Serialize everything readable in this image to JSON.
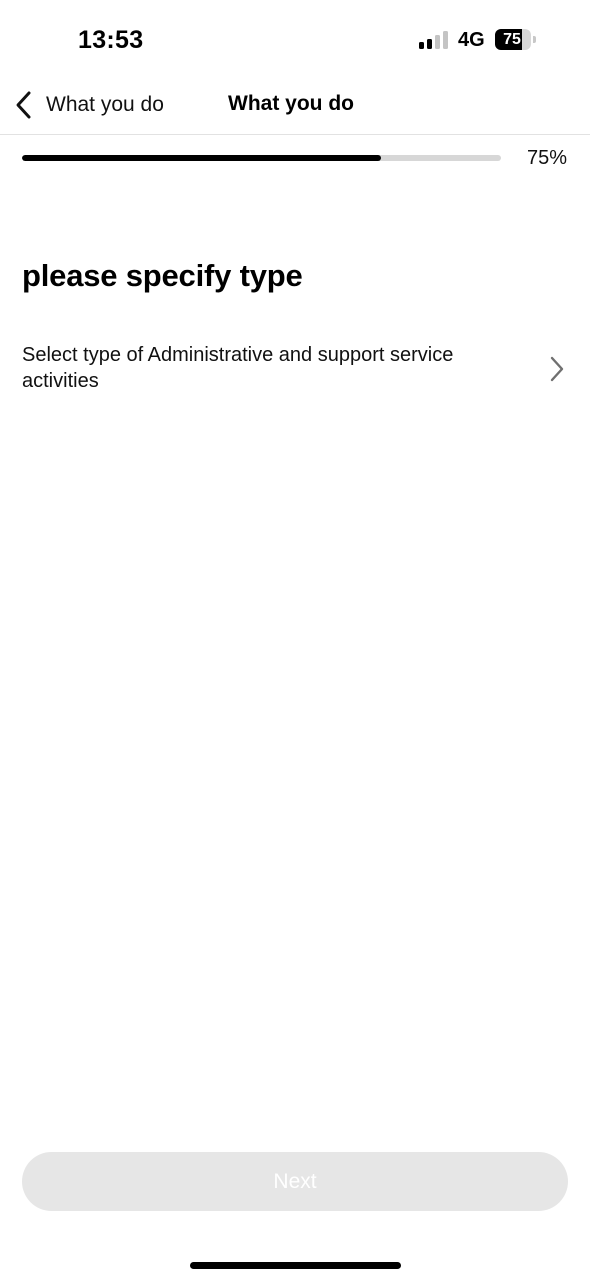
{
  "status_bar": {
    "time": "13:53",
    "network": "4G",
    "battery_level": "75",
    "battery_fraction": 0.75,
    "signal_bars_active": 2,
    "signal_bars_total": 4
  },
  "header": {
    "back_label": "What you do",
    "title": "What you do"
  },
  "progress": {
    "fraction": 0.75,
    "label": "75%"
  },
  "main": {
    "title": "please specify type",
    "select_row": {
      "label": "Select type of Administrative and support service activities",
      "icon": "chevron-right-icon"
    }
  },
  "footer": {
    "next_label": "Next"
  },
  "colors": {
    "accent": "#000000",
    "track": "#d7d7d7",
    "button_disabled_bg": "#e6e6e6",
    "button_disabled_text": "#ffffff",
    "signal_inactive": "#c4c4c4"
  }
}
